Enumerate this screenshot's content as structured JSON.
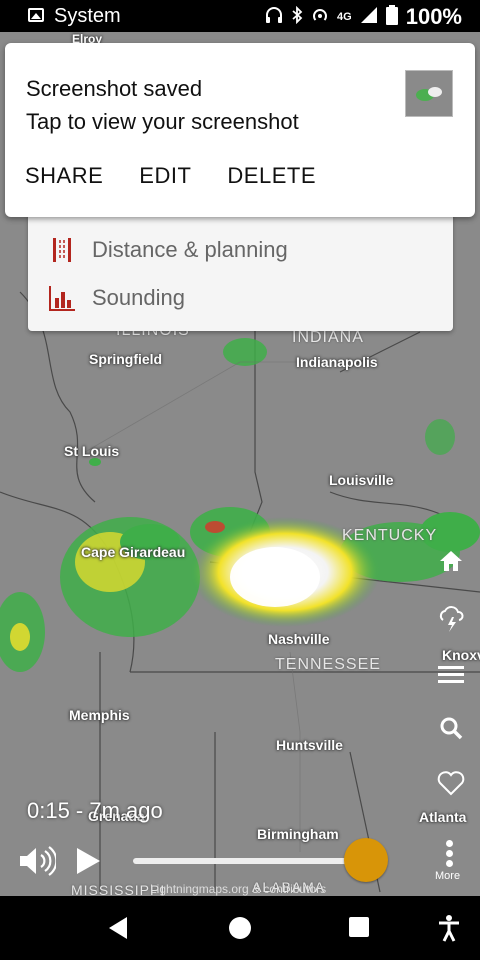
{
  "status_bar": {
    "app_name": "System",
    "network": "4G",
    "battery": "100%",
    "icons": [
      "headphones-icon",
      "bluetooth-icon",
      "hotspot-icon",
      "signal-icon",
      "battery-icon"
    ]
  },
  "notification": {
    "title": "Screenshot saved",
    "text": "Tap to view your screenshot",
    "actions": [
      "SHARE",
      "EDIT",
      "DELETE"
    ]
  },
  "menu": {
    "items": [
      {
        "label": "Distance & planning",
        "icon": "ruler-icon"
      },
      {
        "label": "Sounding",
        "icon": "bar-chart-icon"
      }
    ]
  },
  "map": {
    "labels": {
      "elroy": "Elroy",
      "illinois": "ILLINOIS",
      "indiana": "INDIANA",
      "springfield": "Springfield",
      "indianapolis": "Indianapolis",
      "st_louis": "St Louis",
      "louisville": "Louisville",
      "kentucky": "KENTUCKY",
      "cape_girardeau": "Cape Girardeau",
      "nashville": "Nashville",
      "tennessee": "TENNESSEE",
      "knoxville": "Knoxv",
      "memphis": "Memphis",
      "huntsville": "Huntsville",
      "grenada": "Grenada",
      "birmingham": "Birmingham",
      "atlanta": "Atlanta",
      "mississippi": "MISSISSIPPI",
      "alabama": "ALABAMA"
    },
    "colors": {
      "base": "#8a8a8a",
      "radar_green": "#3fae49",
      "radar_yellow": "#f2e22a",
      "radar_red": "#d9352a"
    }
  },
  "controls": {
    "rail_icons": [
      "home-icon",
      "lightning-cloud-icon",
      "menu-icon",
      "search-icon",
      "heart-icon"
    ],
    "time": "0:15 - 7m ago",
    "progress": 0.93,
    "more_label": "More",
    "attribution": "Lightningmaps.org & contributors",
    "accent": "#d89508"
  },
  "nav_bar": {
    "icons": [
      "back-icon",
      "home-circle-icon",
      "recents-icon",
      "accessibility-icon"
    ]
  }
}
